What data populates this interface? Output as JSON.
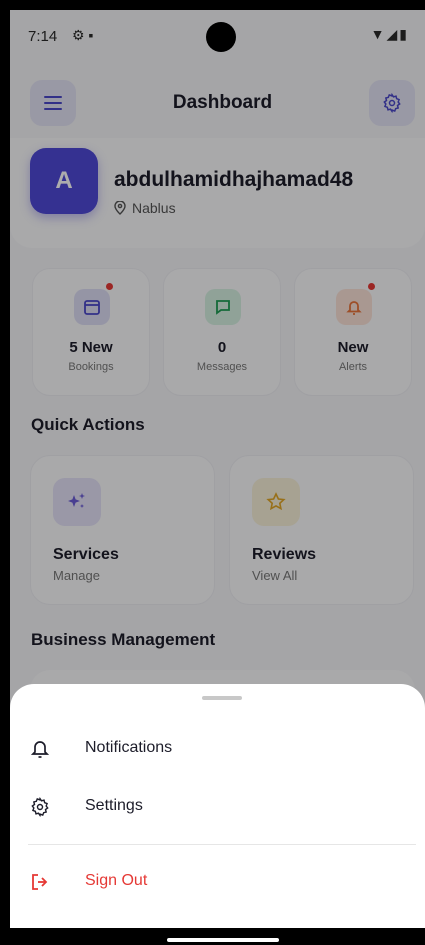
{
  "status_bar": {
    "time": "7:14"
  },
  "header": {
    "title": "Dashboard"
  },
  "profile": {
    "avatar_letter": "A",
    "username": "abdulhamidhajhamad48",
    "location": "Nablus"
  },
  "stats": [
    {
      "value": "5 New",
      "label": "Bookings",
      "icon": "calendar-icon",
      "color": "#4b48c9",
      "bg": "#dcdcf4",
      "dot": true
    },
    {
      "value": "0",
      "label": "Messages",
      "icon": "message-icon",
      "color": "#1f9d55",
      "bg": "#d4efe0",
      "dot": false
    },
    {
      "value": "New",
      "label": "Alerts",
      "icon": "bell-icon",
      "color": "#e8743b",
      "bg": "#f9e1d6",
      "dot": true
    }
  ],
  "quick_actions": {
    "title": "Quick Actions",
    "items": [
      {
        "title": "Services",
        "subtitle": "Manage",
        "icon": "sparkles-icon",
        "color": "#6a5cd6",
        "bg": "#e3e0f6"
      },
      {
        "title": "Reviews",
        "subtitle": "View All",
        "icon": "star-icon",
        "color": "#e0a526",
        "bg": "#f6efd7"
      }
    ]
  },
  "business": {
    "title": "Business Management"
  },
  "sheet": {
    "items": [
      {
        "label": "Notifications",
        "icon": "bell-icon"
      },
      {
        "label": "Settings",
        "icon": "gear-icon"
      },
      {
        "label": "Sign Out",
        "icon": "logout-icon",
        "color": "#e53935"
      }
    ]
  }
}
